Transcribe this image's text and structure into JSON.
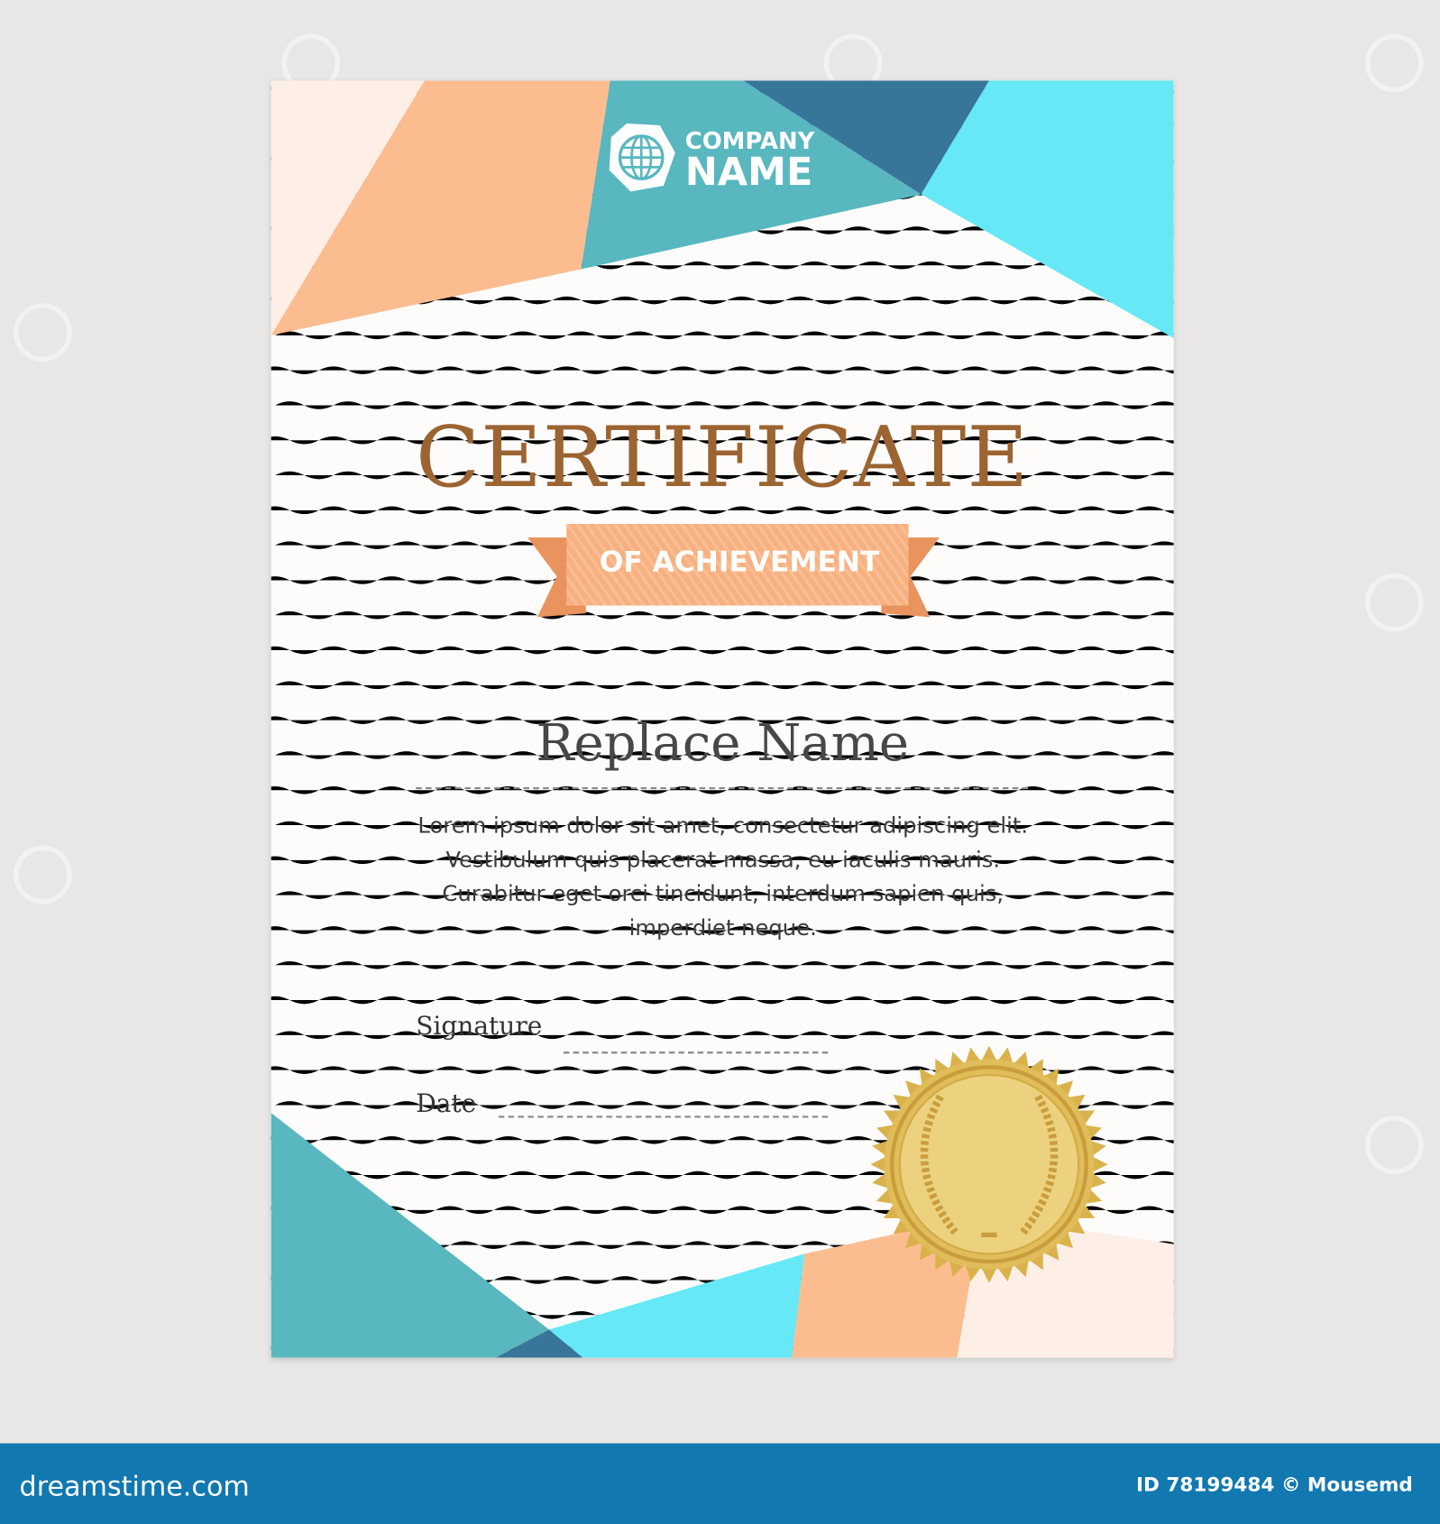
{
  "certificate": {
    "company_line1": "COMPANY",
    "company_line2": "NAME",
    "title": "CERTIFICATE",
    "subtitle": "OF ACHIEVEMENT",
    "recipient_name": "Replace Name",
    "body_lines": [
      "Lorem ipsum dolor sit amet, consectetur adipiscing elit.",
      "Vestibulum quis placerat massa, eu iaculis mauris.",
      "Curabitur eget orci tincidunt, interdum sapien quis,",
      "imperdiet neque."
    ],
    "signature_label": "Signature",
    "date_label": "Date"
  },
  "footer": {
    "site": "dreamstime.com",
    "credit": "ID 78199484 © Mousemd"
  },
  "colors": {
    "background": "#e8e7e5",
    "teal": "#58b7bf",
    "dark_blue": "#377599",
    "cyan": "#66e8f6",
    "peach": "#fbbd90",
    "light_peach": "#fdeee6",
    "title_brown": "#9b6431",
    "footer_blue": "#1178b0",
    "gold": "#e3c15e"
  }
}
